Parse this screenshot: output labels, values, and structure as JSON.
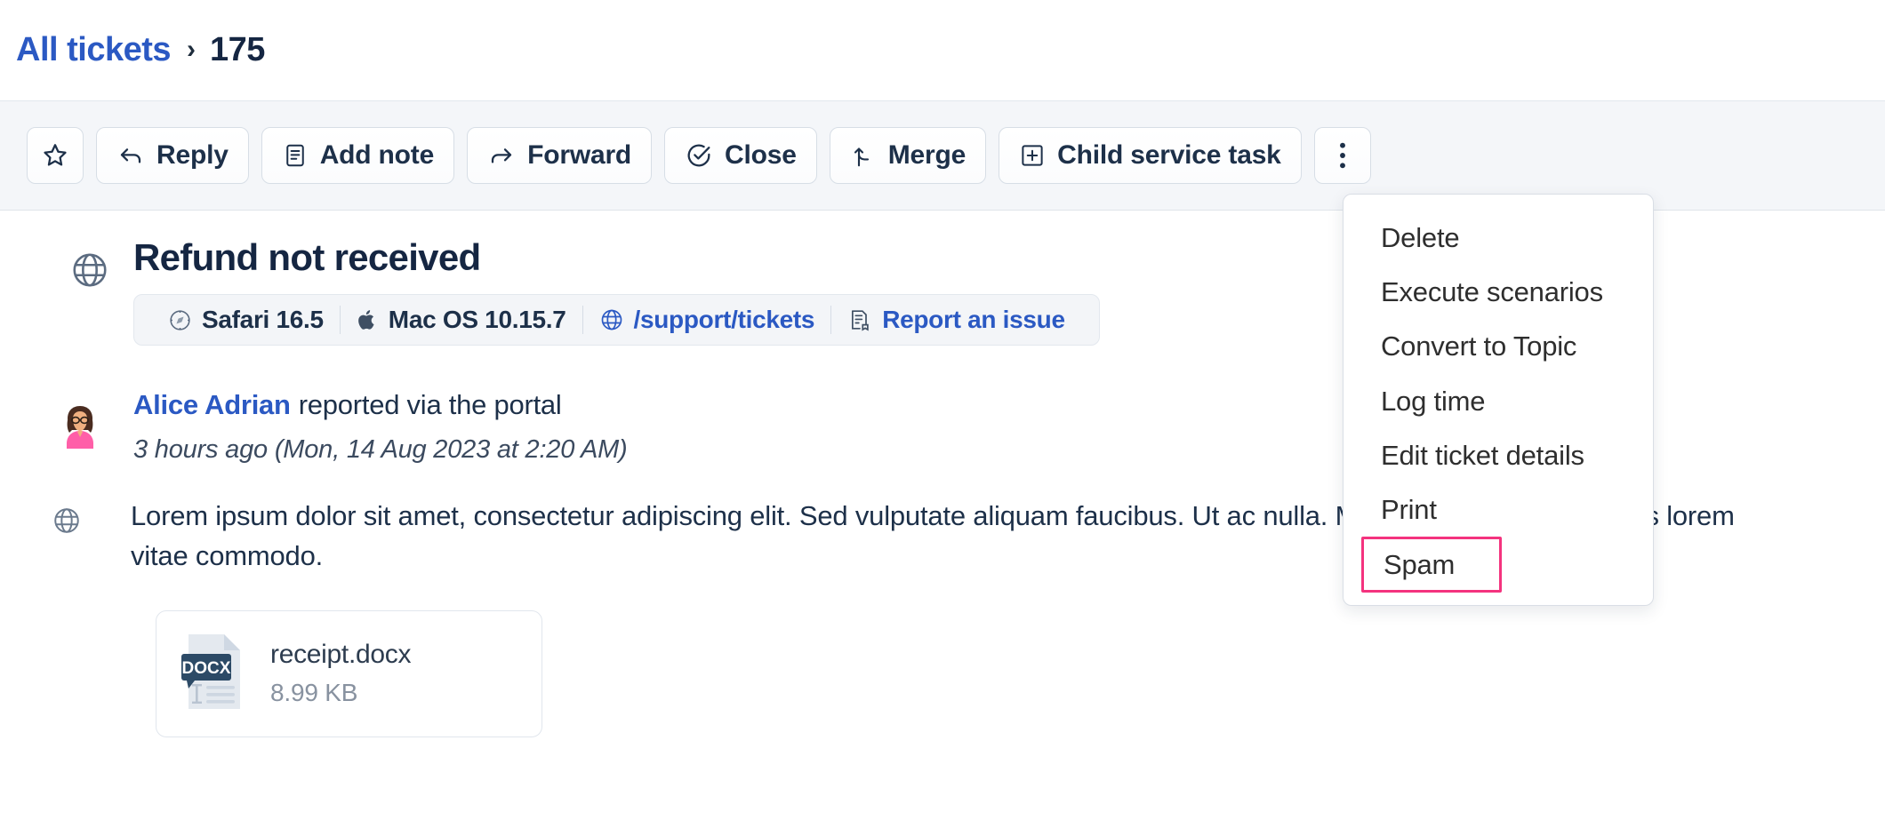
{
  "breadcrumb": {
    "root_label": "All tickets",
    "separator": "›",
    "current_label": "175"
  },
  "toolbar": {
    "favorite_label": "",
    "reply_label": "Reply",
    "add_note_label": "Add note",
    "forward_label": "Forward",
    "close_label": "Close",
    "merge_label": "Merge",
    "child_service_task_label": "Child service task",
    "more_label": ""
  },
  "dropdown": {
    "items": [
      {
        "label": "Delete",
        "highlighted": false
      },
      {
        "label": "Execute scenarios",
        "highlighted": false
      },
      {
        "label": "Convert to Topic",
        "highlighted": false
      },
      {
        "label": "Log time",
        "highlighted": false
      },
      {
        "label": "Edit ticket details",
        "highlighted": false
      },
      {
        "label": "Print",
        "highlighted": false
      },
      {
        "label": "Spam",
        "highlighted": true
      }
    ],
    "highlight_color": "#f4337e"
  },
  "ticket": {
    "title": "Refund not received",
    "meta": [
      {
        "label": "Safari 16.5",
        "icon": "safari-icon",
        "link": false
      },
      {
        "label": "Mac OS 10.15.7",
        "icon": "apple-icon",
        "link": false
      },
      {
        "label": "/support/tickets",
        "icon": "globe-icon",
        "link": true
      },
      {
        "label": "Report an issue",
        "icon": "form-icon",
        "link": true
      }
    ],
    "author": {
      "name": "Alice Adrian",
      "action": "reported via the portal",
      "timestamp": "3 hours ago (Mon, 14 Aug 2023 at 2:20 AM)"
    },
    "message": "Lorem ipsum dolor sit amet, consectetur adipiscing elit. Sed vulputate aliquam faucibus. Ut ac                       nulla. Maecenas sodales tempus lorem vitae commodo.",
    "attachment": {
      "name": "receipt.docx",
      "size": "8.99 KB",
      "type_label": "DOCX"
    }
  },
  "colors": {
    "accent_link": "#2b59c3",
    "text_dark": "#152642",
    "toolbar_bg": "#f4f6f9",
    "highlight_pink": "#f4337e"
  }
}
